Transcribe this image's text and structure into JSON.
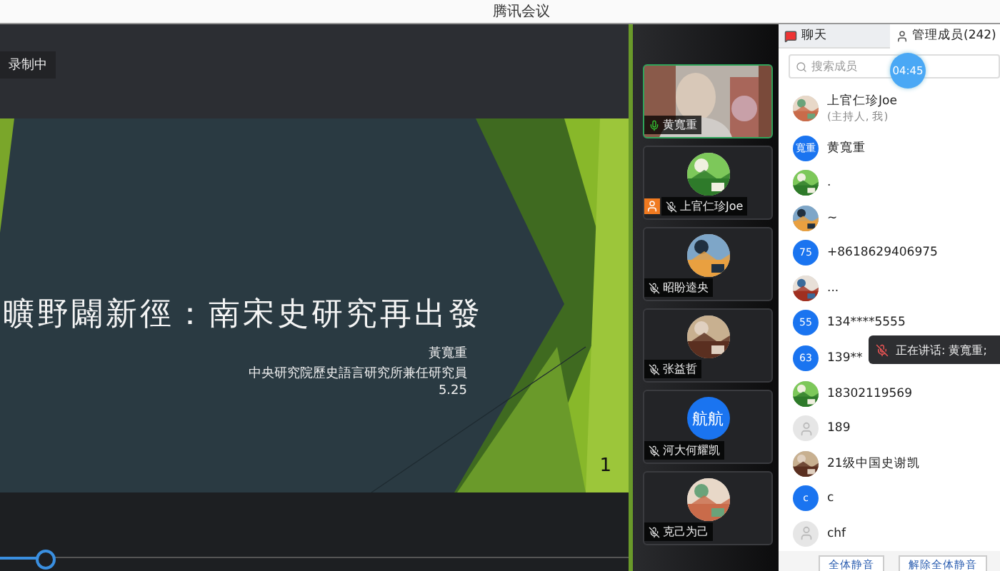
{
  "window": {
    "title": "腾讯会议"
  },
  "recording_badge": "录制中",
  "slide": {
    "title": "曠野闢新徑：南宋史研究再出發",
    "author": "黃寬重",
    "affiliation": "中央研究院歷史語言研究所兼任研究員",
    "date": "5.25",
    "page": "1"
  },
  "playback": {
    "level": 0.07
  },
  "video_tiles": [
    {
      "name": "黄寬重",
      "kind": "camera",
      "muted": false,
      "host": false,
      "speaking": true
    },
    {
      "name": "上官仁珍Joe",
      "kind": "picture",
      "muted": true,
      "host": true,
      "speaking": false
    },
    {
      "name": "昭盼逵央",
      "kind": "picture",
      "muted": true,
      "host": false,
      "speaking": false
    },
    {
      "name": "张益哲",
      "kind": "picture",
      "muted": true,
      "host": false,
      "speaking": false
    },
    {
      "name": "河大何耀凯",
      "kind": "initials",
      "initials": "航航",
      "muted": true,
      "host": false,
      "speaking": false
    },
    {
      "name": "克己为己",
      "kind": "picture",
      "muted": true,
      "host": false,
      "speaking": false
    }
  ],
  "tabs": [
    {
      "label": "聊天",
      "selected": false,
      "kind": "chat"
    },
    {
      "label": "管理成员(242)",
      "selected": true,
      "kind": "members"
    }
  ],
  "search": {
    "placeholder": "搜索成员"
  },
  "timer": "04:45",
  "members": [
    {
      "name": "上官仁珍Joe",
      "role": "(主持人, 我)",
      "kind": "picture"
    },
    {
      "name": "黄寬重",
      "kind": "initials",
      "initials": "寬重"
    },
    {
      "name": ".",
      "kind": "picture"
    },
    {
      "name": "~",
      "kind": "picture"
    },
    {
      "name": "+8618629406975",
      "kind": "initials",
      "initials": "75"
    },
    {
      "name": "...",
      "kind": "picture"
    },
    {
      "name": "134****5555",
      "kind": "initials",
      "initials": "55"
    },
    {
      "name": "139**",
      "kind": "initials",
      "initials": "63"
    },
    {
      "name": "18302119569",
      "kind": "picture"
    },
    {
      "name": "189",
      "kind": "placeholder"
    },
    {
      "name": "21级中国史谢凯",
      "kind": "picture"
    },
    {
      "name": "c",
      "kind": "initials",
      "initials": "c"
    },
    {
      "name": "chf",
      "kind": "placeholder"
    }
  ],
  "speaking_tooltip": "正在讲话: 黄寬重;",
  "buttons": [
    "全体静音",
    "解除全体静音"
  ]
}
